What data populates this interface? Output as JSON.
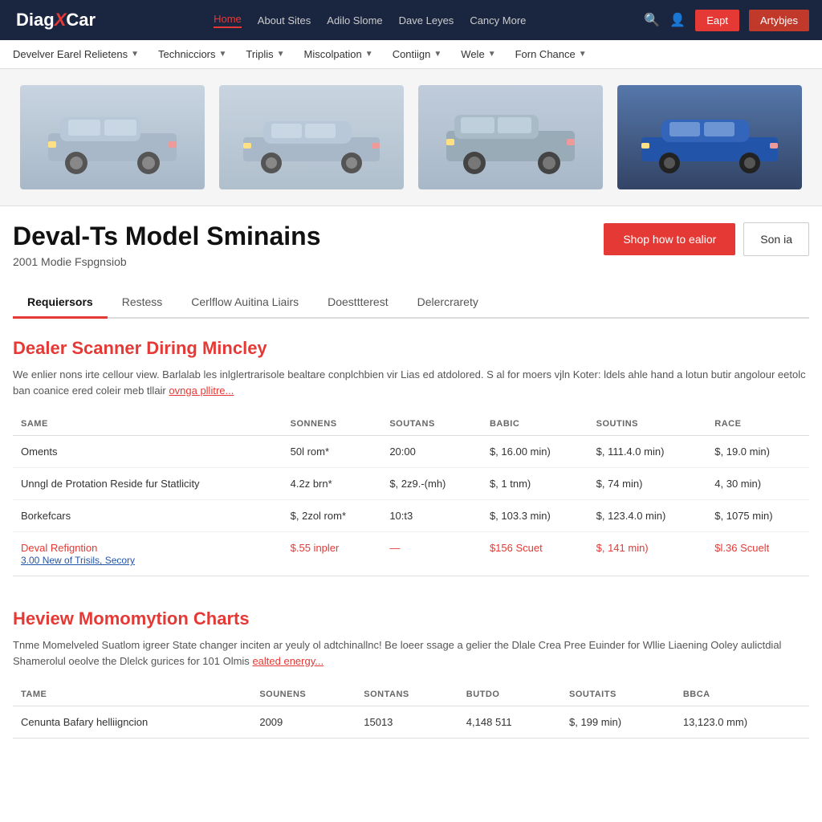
{
  "header": {
    "logo": "DiagXCar",
    "logo_icon": "e",
    "nav": [
      {
        "label": "Home",
        "active": true
      },
      {
        "label": "About Sites"
      },
      {
        "label": "Adilo Slome"
      },
      {
        "label": "Dave Leyes"
      },
      {
        "label": "Cancy More"
      }
    ],
    "btn_login": "Eapt",
    "btn_register": "Artybjes"
  },
  "secondary_nav": [
    {
      "label": "Develver Earel Relietens"
    },
    {
      "label": "Technicciors"
    },
    {
      "label": "Triplis"
    },
    {
      "label": "Miscolpation"
    },
    {
      "label": "Contiign"
    },
    {
      "label": "Wele"
    },
    {
      "label": "Forn Chance"
    }
  ],
  "page_title": "Deval-Ts Model Sminains",
  "page_subtitle": "2001 Modie Fspgnsiob",
  "btn_shop": "Shop how to ealior",
  "btn_son": "Son ia",
  "tabs": [
    {
      "label": "Requiersors",
      "active": true
    },
    {
      "label": "Restess"
    },
    {
      "label": "Cerlflow Auitina Liairs"
    },
    {
      "label": "Doesttterest"
    },
    {
      "label": "Delercrarety"
    }
  ],
  "section1": {
    "title": "Dealer Scanner Diring Mincley",
    "desc": "We enlier nons irte cellour view. Barlalab les inlglertrarisole bealtare conplchbien vir Lias ed atdolored. S al for moers vjln Koter: ldels ahle hand a lotun butir angolour eetolc ban coanice ered coleir meb tllair",
    "desc_link": "ovnga pllitre...",
    "columns": [
      "SAME",
      "SONNENS",
      "SOUTANS",
      "BABIC",
      "SOUTINS",
      "RACE"
    ],
    "rows": [
      {
        "name": "Oments",
        "sonnens": "50l rom*",
        "soutans": "20:00",
        "babic": "$, 16.00 min)",
        "soutins": "$, 111.4.0 min)",
        "race": "$, 19.0 min)",
        "red": false
      },
      {
        "name": "Unngl de Protation Reside fur Statlicity",
        "sonnens": "4.2z brn*",
        "soutans": "$, 2z9.-(mh)",
        "babic": "$, 1 tnm)",
        "soutins": "$, 74 min)",
        "race": "4, 30 min)",
        "red": false
      },
      {
        "name": "Borkefcars",
        "sonnens": "$, 2zol rom*",
        "soutans": "10:t3",
        "babic": "$, 103.3 min)",
        "soutins": "$, 123.4.0 min)",
        "race": "$, 1075 min)",
        "red": false
      },
      {
        "name": "Deval Refigntion",
        "name_sub": "3.00 New of Trisils, Secory",
        "sonnens": "$.55 inpler",
        "soutans": "—",
        "babic": "$156 Scuet",
        "soutins": "$, 141 min)",
        "race": "$l.36 Scuelt",
        "red": true
      }
    ]
  },
  "section2": {
    "title": "Heview Momomytion Charts",
    "desc": "Tnme Momelveled Suatlom igreer State changer inciten ar yeuly ol adtchinallnc! Be loeer ssage a gelier the Dlale Crea Pree Euinder for Wllie Liaening Ooley aulictdial Shamerolul oeolve the Dlelck gurices for 101 Olmis",
    "desc_link": "ealted energy...",
    "columns": [
      "TAME",
      "SOUNENS",
      "SONTANS",
      "BUTDO",
      "SOUTAITS",
      "BBCA"
    ],
    "rows": [
      {
        "name": "Cenunta Bafary helliigncion",
        "sonnens": "2009",
        "soutans": "15013",
        "babic": "4,148 511",
        "soutins": "$, 199 min)",
        "race": "13,123.0 mm)",
        "red": false
      }
    ]
  }
}
